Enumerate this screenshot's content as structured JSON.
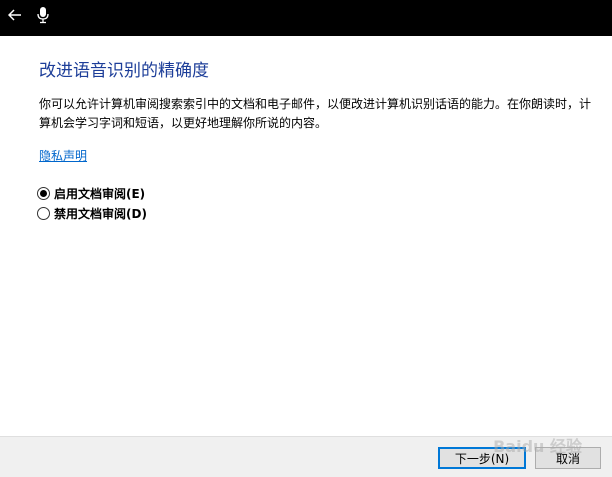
{
  "header": {
    "back_icon": "back-arrow-icon",
    "mic_icon": "microphone-icon"
  },
  "main": {
    "title": "改进语音识别的精确度",
    "description": "你可以允许计算机审阅搜索索引中的文档和电子邮件，以便改进计算机识别话语的能力。在你朗读时，计算机会学习字词和短语，以更好地理解你所说的内容。",
    "privacy_link": "隐私声明",
    "options": [
      {
        "label": "启用文档审阅(E)",
        "checked": true
      },
      {
        "label": "禁用文档审阅(D)",
        "checked": false
      }
    ]
  },
  "footer": {
    "next_label": "下一步(N)",
    "cancel_label": "取消"
  },
  "watermark": "Baidu 经验",
  "colors": {
    "title": "#1d3e99",
    "link": "#0066cc",
    "titlebar": "#000000",
    "accent": "#0078d7"
  }
}
